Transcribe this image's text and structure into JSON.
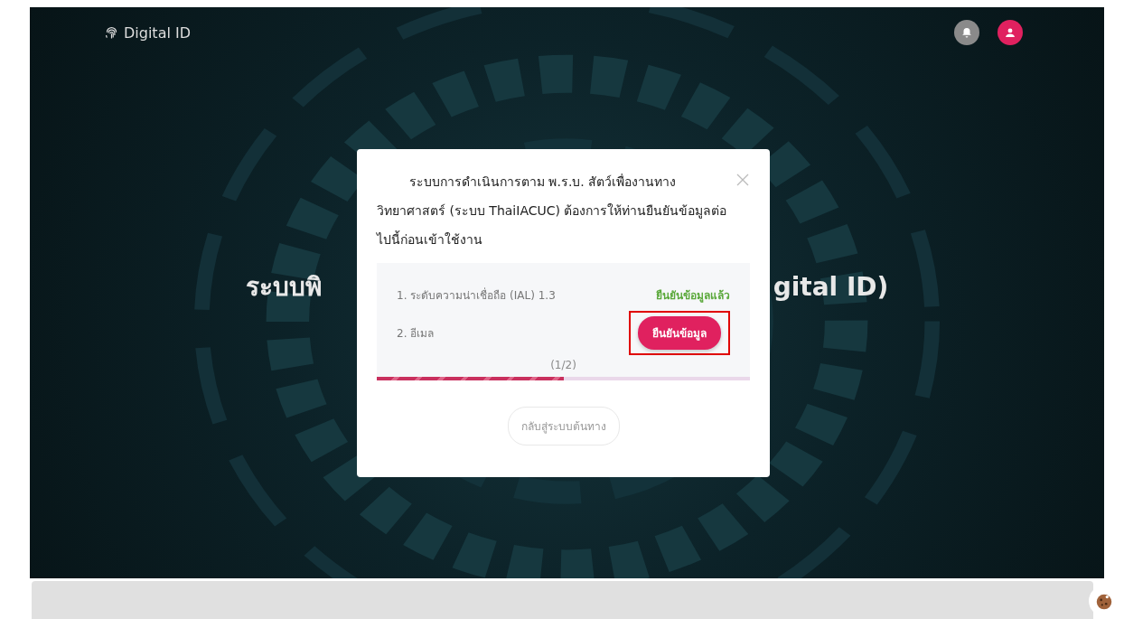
{
  "brand": {
    "name": "Digital ID"
  },
  "hero": {
    "heading_left": "ระบบพิ",
    "heading_right": "gital ID)"
  },
  "modal": {
    "message": "ระบบการดำเนินการตาม พ.ร.บ. สัตว์เพื่องานทางวิทยาศาสตร์ (ระบบ ThaiIACUC) ต้องการให้ท่านยืนยันข้อมูลต่อไปนี้ก่อนเข้าใช้งาน",
    "items": [
      {
        "label": "1. ระดับความน่าเชื่อถือ (IAL) 1.3",
        "kind": "done",
        "status": "ยืนยันข้อมูลแล้ว",
        "highlighted": false
      },
      {
        "label": "2. อีเมล",
        "kind": "pending",
        "status": "ยืนยันข้อมูล",
        "highlighted": true
      }
    ],
    "progress": {
      "label": "(1/2)",
      "level": 0.5
    },
    "back_button": "กลับสู่ระบบต้นทาง"
  }
}
